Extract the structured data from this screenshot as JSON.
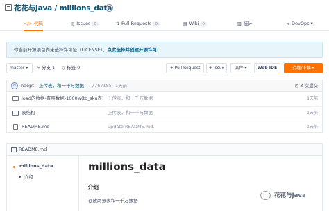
{
  "repo": {
    "owner": "花花与Java",
    "separator": "/",
    "name": "millions_data"
  },
  "tabs": [
    {
      "icon": "</>",
      "label": "代码"
    },
    {
      "label": "Issues",
      "count": "0"
    },
    {
      "label": "Pull Requests",
      "count": "0"
    },
    {
      "label": "Wiki",
      "count": "0"
    },
    {
      "label": "统计"
    },
    {
      "label": "DevOps",
      "arrow": "▾"
    }
  ],
  "notice": {
    "text": "你当前开源项目尚未选择许可证（LICENSE），",
    "link": "点此选择并创建开源许可"
  },
  "toolbar": {
    "branch": "master",
    "branch_arrow": "▾",
    "branches": "分支 1",
    "tags": "标签 0",
    "pull_request": "+ Pull Request",
    "issue": "+ Issue",
    "file_menu": "文件",
    "web_ide": "Web IDE",
    "clone": "克隆/下载"
  },
  "commit": {
    "author": "haopt",
    "message": "上传表，和一千万数据",
    "hash": "7767185",
    "time": "1天前",
    "count": "3 次提交"
  },
  "files": [
    {
      "name": "load的数据-有序数据-1000w(tb_sku表)",
      "message": "上传表，和一千万数据",
      "time": "1天前",
      "type": "folder"
    },
    {
      "name": "表结构",
      "message": "上传表，和一千万数据",
      "time": "1天前",
      "type": "folder"
    },
    {
      "name": "README.md",
      "message": "update README.md.",
      "time": "1天前",
      "type": "file"
    }
  ],
  "readme": {
    "file": "README.md",
    "toc": [
      "millions_data",
      "介绍"
    ],
    "h1": "millions_data",
    "h3": "介绍",
    "text": "存放两张表和一千万数据"
  },
  "watermark": "花花与Java",
  "colors": {
    "accent": "#fe7300",
    "link": "#005980",
    "notice_bg": "#e8f6fb"
  }
}
